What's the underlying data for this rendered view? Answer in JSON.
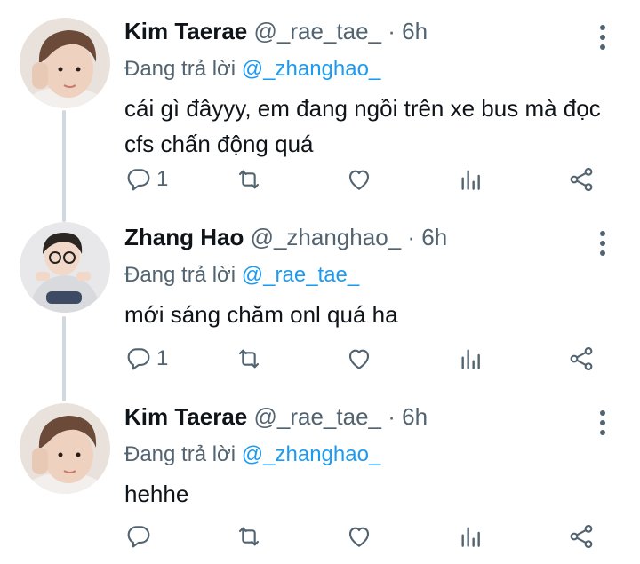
{
  "tweets": [
    {
      "name": "Kim Taerae",
      "handle": "@_rae_tae_",
      "separator": "·",
      "time": "6h",
      "reply_prefix": "Đang trả lời",
      "reply_to": "@_zhanghao_",
      "text": "cái gì đâyyy, em đang ngồi trên xe bus mà đọc cfs chấn động quá",
      "reply_count": "1",
      "retweet_count": "",
      "like_count": ""
    },
    {
      "name": "Zhang Hao",
      "handle": "@_zhanghao_",
      "separator": "·",
      "time": "6h",
      "reply_prefix": "Đang trả lời",
      "reply_to": "@_rae_tae_",
      "text": "mới sáng chăm onl quá ha",
      "reply_count": "1",
      "retweet_count": "",
      "like_count": ""
    },
    {
      "name": "Kim Taerae",
      "handle": "@_rae_tae_",
      "separator": "·",
      "time": "6h",
      "reply_prefix": "Đang trả lời",
      "reply_to": "@_zhanghao_",
      "text": "hehhe",
      "reply_count": "",
      "retweet_count": "",
      "like_count": ""
    }
  ],
  "colors": {
    "text": "#0f1419",
    "muted": "#536471",
    "link": "#1d9bf0",
    "thread_line": "#cfd9de"
  },
  "icons": {
    "reply": "reply-icon",
    "retweet": "retweet-icon",
    "like": "heart-icon",
    "views": "analytics-icon",
    "share": "share-icon",
    "more": "more-vertical-icon"
  }
}
